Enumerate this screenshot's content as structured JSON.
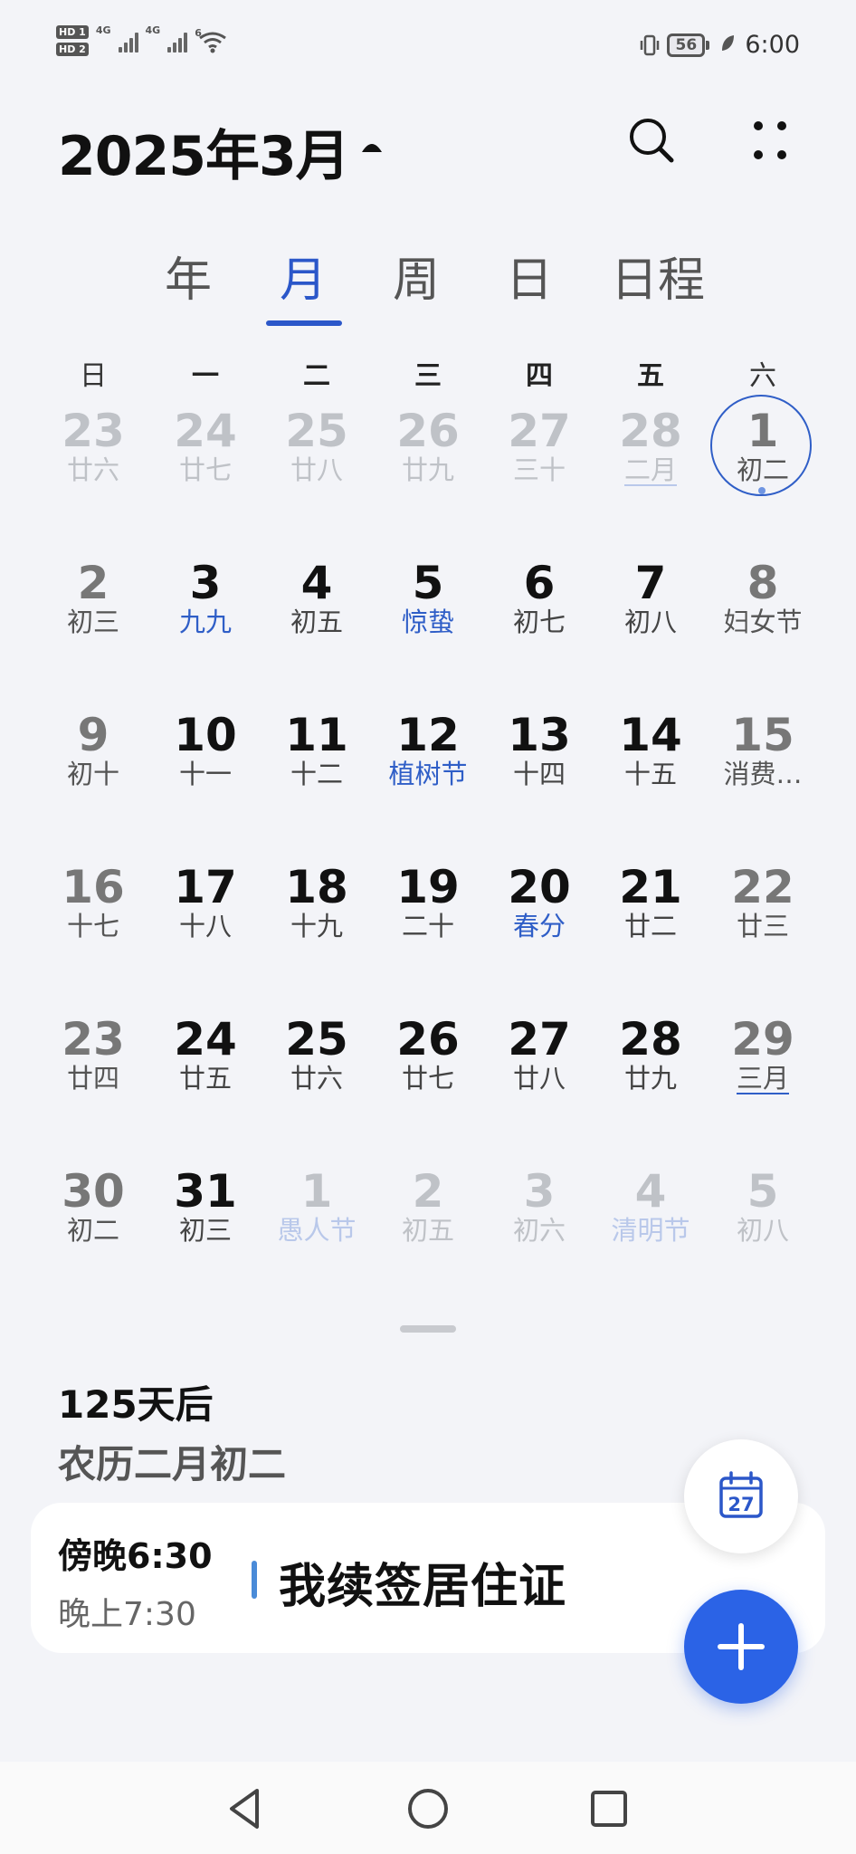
{
  "status_bar": {
    "hd1": "HD 1",
    "hd2": "HD 2",
    "net1": "4G",
    "net2": "4G",
    "wifi_label": "6",
    "battery": "56",
    "time": "6:00"
  },
  "header": {
    "title": "2025年3月"
  },
  "tabs": [
    {
      "label": "年"
    },
    {
      "label": "月"
    },
    {
      "label": "周"
    },
    {
      "label": "日"
    },
    {
      "label": "日程"
    }
  ],
  "weekdays": [
    "日",
    "一",
    "二",
    "三",
    "四",
    "五",
    "六"
  ],
  "weeks": [
    [
      {
        "day": "23",
        "sub": "廿六",
        "faded": true
      },
      {
        "day": "24",
        "sub": "廿七",
        "faded": true
      },
      {
        "day": "25",
        "sub": "廿八",
        "faded": true
      },
      {
        "day": "26",
        "sub": "廿九",
        "faded": true
      },
      {
        "day": "27",
        "sub": "三十",
        "faded": true
      },
      {
        "day": "28",
        "sub": "二月",
        "faded": true,
        "month_mark": true
      },
      {
        "day": "1",
        "sub": "初二",
        "today": true
      }
    ],
    [
      {
        "day": "2",
        "sub": "初三"
      },
      {
        "day": "3",
        "sub": "九九",
        "holiday": true
      },
      {
        "day": "4",
        "sub": "初五"
      },
      {
        "day": "5",
        "sub": "惊蛰",
        "holiday": true
      },
      {
        "day": "6",
        "sub": "初七"
      },
      {
        "day": "7",
        "sub": "初八"
      },
      {
        "day": "8",
        "sub": "妇女节",
        "holiday": true
      }
    ],
    [
      {
        "day": "9",
        "sub": "初十"
      },
      {
        "day": "10",
        "sub": "十一"
      },
      {
        "day": "11",
        "sub": "十二"
      },
      {
        "day": "12",
        "sub": "植树节",
        "holiday": true
      },
      {
        "day": "13",
        "sub": "十四"
      },
      {
        "day": "14",
        "sub": "十五"
      },
      {
        "day": "15",
        "sub": "消费…",
        "holiday": true
      }
    ],
    [
      {
        "day": "16",
        "sub": "十七"
      },
      {
        "day": "17",
        "sub": "十八"
      },
      {
        "day": "18",
        "sub": "十九"
      },
      {
        "day": "19",
        "sub": "二十"
      },
      {
        "day": "20",
        "sub": "春分",
        "holiday": true
      },
      {
        "day": "21",
        "sub": "廿二"
      },
      {
        "day": "22",
        "sub": "廿三"
      }
    ],
    [
      {
        "day": "23",
        "sub": "廿四"
      },
      {
        "day": "24",
        "sub": "廿五"
      },
      {
        "day": "25",
        "sub": "廿六"
      },
      {
        "day": "26",
        "sub": "廿七"
      },
      {
        "day": "27",
        "sub": "廿八"
      },
      {
        "day": "28",
        "sub": "廿九"
      },
      {
        "day": "29",
        "sub": "三月",
        "month_mark": true
      }
    ],
    [
      {
        "day": "30",
        "sub": "初二"
      },
      {
        "day": "31",
        "sub": "初三"
      },
      {
        "day": "1",
        "sub": "愚人节",
        "faded": true,
        "holiday": true
      },
      {
        "day": "2",
        "sub": "初五",
        "faded": true
      },
      {
        "day": "3",
        "sub": "初六",
        "faded": true
      },
      {
        "day": "4",
        "sub": "清明节",
        "faded": true,
        "holiday": true
      },
      {
        "day": "5",
        "sub": "初八",
        "faded": true
      }
    ]
  ],
  "info": {
    "days_after": "125天后",
    "lunar_date": "农历二月初二"
  },
  "event": {
    "start": "傍晚6:30",
    "end": "晚上7:30",
    "title": "我续签居住证",
    "color": "#4a8bd8"
  },
  "fab": {
    "today_day": "27",
    "add_icon": "plus-icon"
  },
  "colors": {
    "accent": "#2b57c9",
    "holiday": "#2f5ec7",
    "fab": "#2b63e6"
  }
}
